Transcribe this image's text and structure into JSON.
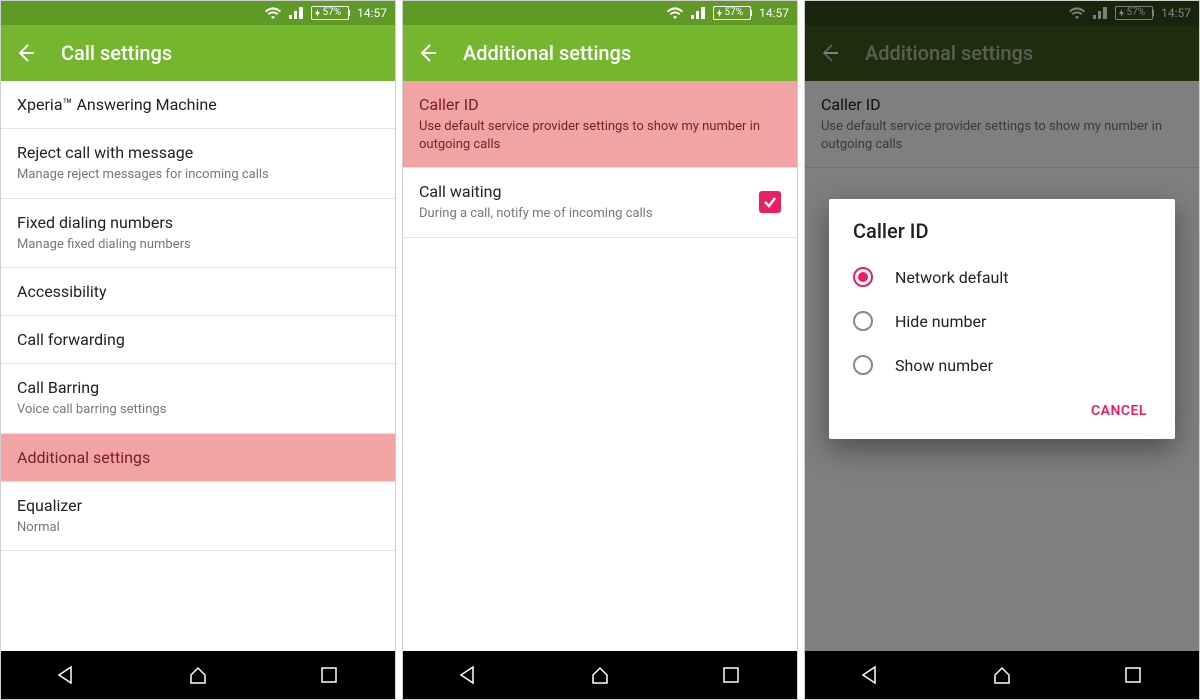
{
  "status": {
    "battery": "57%",
    "time": "14:57"
  },
  "screen1": {
    "title": "Call settings",
    "items": [
      {
        "title": "Xperia™ Answering Machine",
        "sub": ""
      },
      {
        "title": "Reject call with message",
        "sub": "Manage reject messages for incoming calls"
      },
      {
        "title": "Fixed dialing numbers",
        "sub": "Manage fixed dialing numbers"
      },
      {
        "title": "Accessibility",
        "sub": ""
      },
      {
        "title": "Call forwarding",
        "sub": ""
      },
      {
        "title": "Call Barring",
        "sub": "Voice call barring settings"
      },
      {
        "title": "Additional settings",
        "sub": "",
        "highlight": true
      },
      {
        "title": "Equalizer",
        "sub": "Normal"
      }
    ]
  },
  "screen2": {
    "title": "Additional settings",
    "callerid": {
      "title": "Caller ID",
      "sub": "Use default service provider settings to show my number in outgoing calls"
    },
    "callwaiting": {
      "title": "Call waiting",
      "sub": "During a call, notify me of incoming calls",
      "checked": true
    }
  },
  "screen3": {
    "title": "Additional settings",
    "callerid": {
      "title": "Caller ID",
      "sub": "Use default service provider settings to show my number in outgoing calls"
    },
    "dialog": {
      "title": "Caller ID",
      "options": [
        {
          "label": "Network default",
          "selected": true
        },
        {
          "label": "Hide number",
          "selected": false
        },
        {
          "label": "Show number",
          "selected": false
        }
      ],
      "cancel": "CANCEL"
    }
  }
}
